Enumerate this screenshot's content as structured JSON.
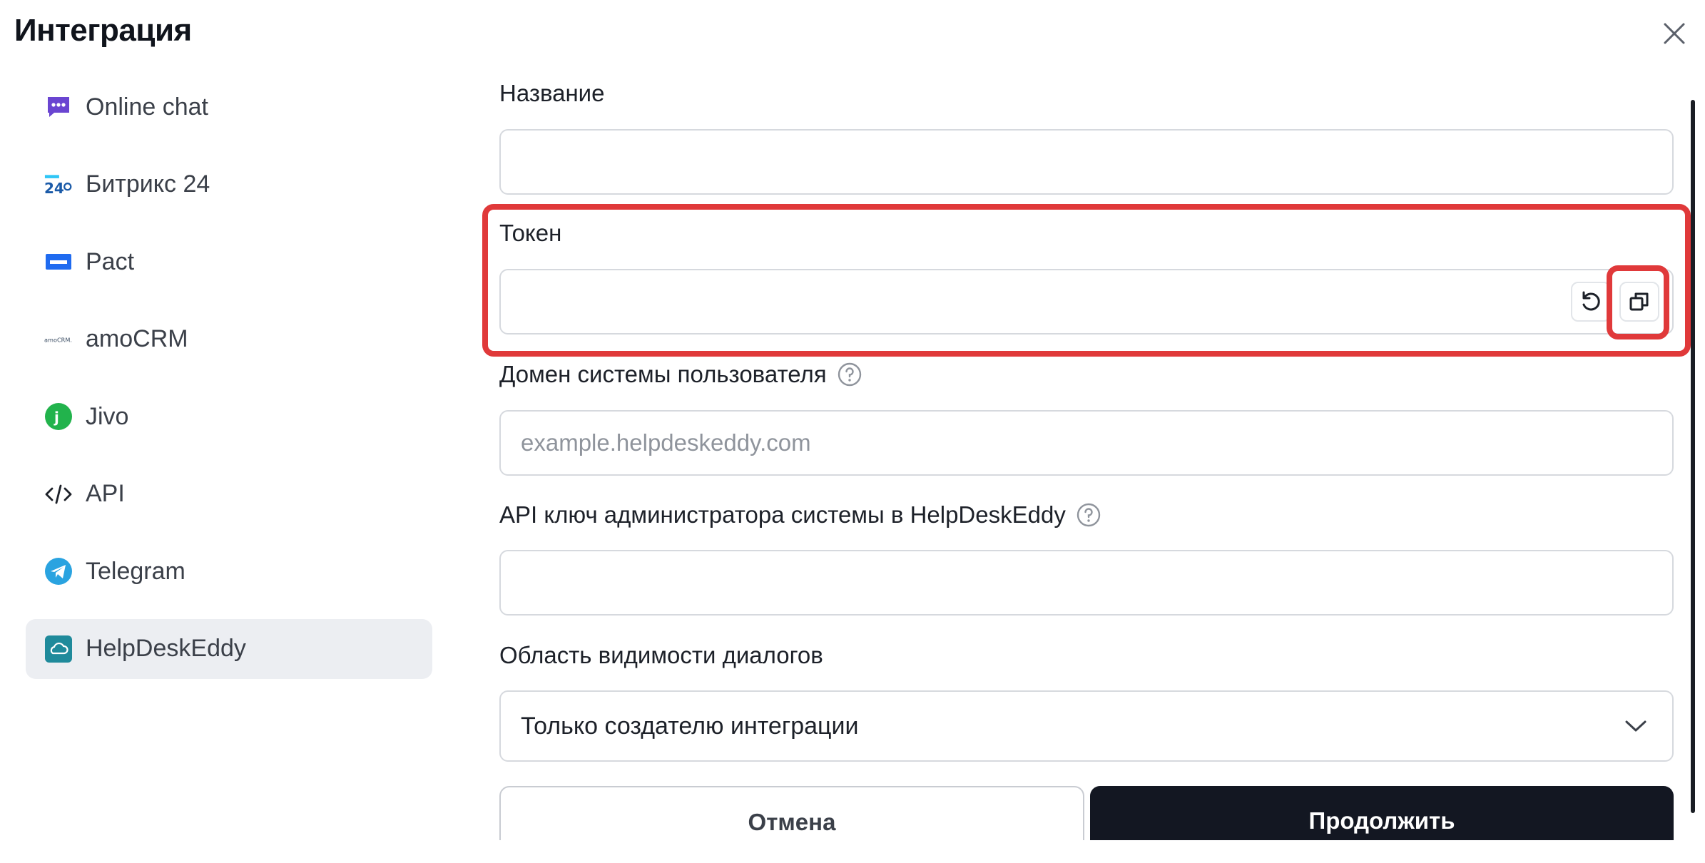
{
  "header": {
    "title": "Интеграция"
  },
  "sidebar": {
    "items": [
      {
        "label": "Online chat",
        "icon": "chat-bubble-icon"
      },
      {
        "label": "Битрикс 24",
        "icon": "bitrix24-logo-icon"
      },
      {
        "label": "Pact",
        "icon": "pact-logo-icon"
      },
      {
        "label": "amoCRM",
        "icon": "amocrm-logo-icon"
      },
      {
        "label": "Jivo",
        "icon": "jivo-logo-icon"
      },
      {
        "label": "API",
        "icon": "code-icon"
      },
      {
        "label": "Telegram",
        "icon": "telegram-icon"
      },
      {
        "label": "HelpDeskEddy",
        "icon": "helpdeskeddy-cloud-icon",
        "active": true
      }
    ]
  },
  "form": {
    "name": {
      "label": "Название",
      "value": ""
    },
    "token": {
      "label": "Токен",
      "value": ""
    },
    "domain": {
      "label": "Домен системы пользователя",
      "placeholder": "example.helpdeskeddy.com"
    },
    "api_key": {
      "label": "API ключ администратора системы в HelpDeskEddy",
      "value": ""
    },
    "visibility": {
      "label": "Область видимости диалогов",
      "value": "Только создателю интеграции"
    }
  },
  "buttons": {
    "cancel": "Отмена",
    "continue": "Продолжить"
  },
  "colors": {
    "highlight": "#e0393a",
    "primary": "#131722",
    "active_bg": "#eceef2"
  }
}
